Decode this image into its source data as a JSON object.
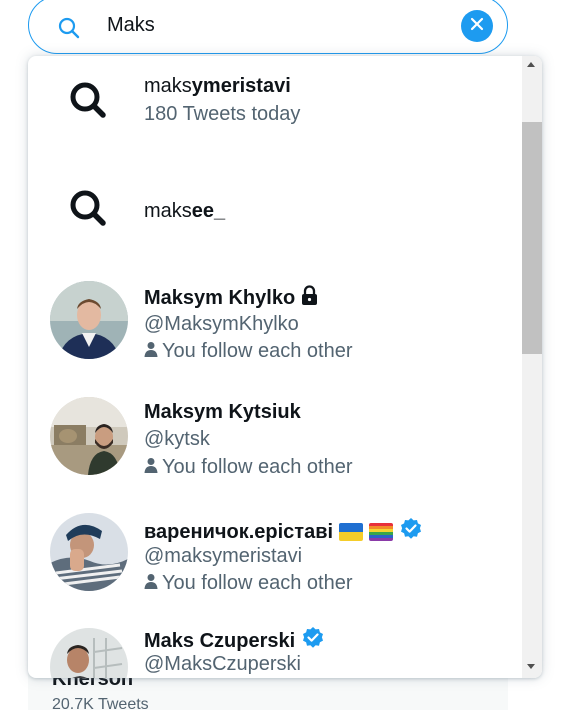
{
  "search": {
    "query": "Maks"
  },
  "background": {
    "title": "Kherson",
    "subtitle": "20.7K Tweets"
  },
  "suggestions": [
    {
      "prefix": "maks",
      "rest": "ymeristavi",
      "sub": "180 Tweets today"
    },
    {
      "prefix": "maks",
      "rest": "ee_",
      "sub": ""
    }
  ],
  "users": [
    {
      "name": "Maksym Khylko",
      "handle": "@MaksymKhylko",
      "follow": "You follow each other",
      "locked": true,
      "verified": false
    },
    {
      "name": "Maksym Kytsiuk",
      "handle": "@kytsk",
      "follow": "You follow each other",
      "locked": false,
      "verified": false
    },
    {
      "name": "вареничок.еріставі",
      "handle": "@maksymeristavi",
      "follow": "You follow each other",
      "locked": false,
      "verified": true
    },
    {
      "name": "Maks Czuperski",
      "handle": "@MaksCzuperski",
      "follow": "",
      "locked": false,
      "verified": true
    }
  ],
  "colors": {
    "accent": "#1d9bf0",
    "secondary_text": "#536471",
    "primary_text": "#0f1419"
  }
}
